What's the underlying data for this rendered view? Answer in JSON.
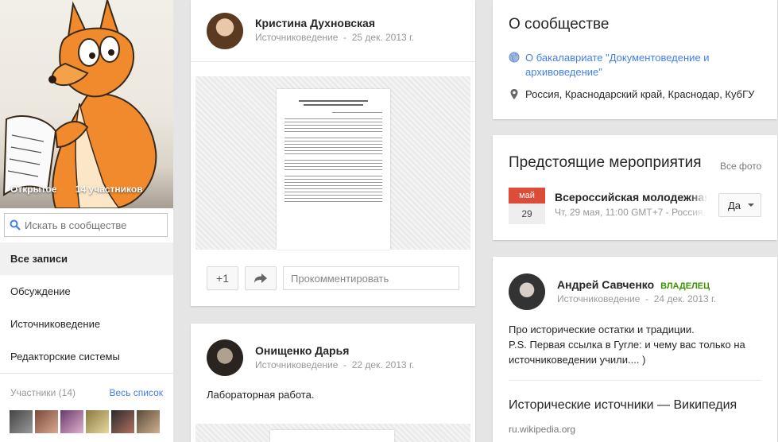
{
  "community": {
    "privacy": "Открытое",
    "members_count": "14 участников"
  },
  "search": {
    "placeholder": "Искать в сообществе"
  },
  "nav": [
    {
      "label": "Все записи"
    },
    {
      "label": "Обсуждение"
    },
    {
      "label": "Источниковедение"
    },
    {
      "label": "Редакторские системы"
    }
  ],
  "members": {
    "label": "Участники (14)",
    "link": "Весь список"
  },
  "post1": {
    "author": "Кристина Духновская",
    "category": "Источниковедение",
    "date": "25 дек. 2013 г.",
    "plus_label": "+1",
    "comment_placeholder": "Прокомментировать"
  },
  "post2": {
    "author": "Онищенко Дарья",
    "category": "Источниковедение",
    "date": "22 дек. 2013 г.",
    "text": "Лабораторная работа."
  },
  "about": {
    "title": "О сообществе",
    "link": "О бакалавриате \"Документоведение и архивоведение\"",
    "location": "Россия, Краснодарский край, Краснодар, КубГУ"
  },
  "events": {
    "title": "Предстоящие мероприятия",
    "all_photos": "Все фото",
    "month": "май",
    "day": "29",
    "event_title": "Всероссийская молодежная",
    "event_meta": "Чт, 29 мая, 11:00 GMT+7 - Россия,",
    "rsvp": "Да"
  },
  "post3": {
    "author": "Андрей Савченко",
    "role": "ВЛАДЕЛЕЦ",
    "category": "Источниковедение",
    "date": "24 дек. 2013 г.",
    "text_line1": "Про исторические остатки и традиции.",
    "text_line2": "P.S. Первая ссылка в Гугле: и чему вас только на",
    "text_line3": "источниковедении учили.... )",
    "link_title": "Исторические источники — Википедия",
    "link_url": "ru.wikipedia.org"
  },
  "colors": {
    "accent": "#427fed",
    "owner": "#3d9400",
    "calendar": "#dd4b39"
  }
}
